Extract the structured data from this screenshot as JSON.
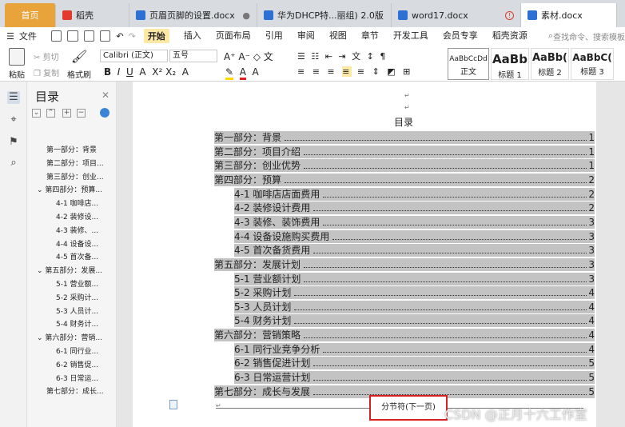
{
  "tabs": [
    {
      "label": "首页",
      "icon": "home"
    },
    {
      "label": "稻壳",
      "icon": "docer-icon"
    },
    {
      "label": "页眉页脚的设置.docx",
      "icon": "word-doc-icon",
      "mark": "●"
    },
    {
      "label": "华为DHCP特...丽组) 2.0版",
      "icon": "word-doc-icon"
    },
    {
      "label": "word17.docx",
      "icon": "word-doc-icon",
      "mark": "!"
    },
    {
      "label": "素材.docx",
      "icon": "word-doc-icon"
    }
  ],
  "menu": {
    "file": "文件",
    "items": [
      "开始",
      "插入",
      "页面布局",
      "引用",
      "审阅",
      "视图",
      "章节",
      "开发工具",
      "会员专享",
      "稻壳资源"
    ],
    "active": "开始",
    "search": "查找命令、搜索模板"
  },
  "ribbon": {
    "paste": "粘贴",
    "cut": "剪切",
    "copy": "复制",
    "format_painter": "格式刷",
    "font_name": "Calibri (正文)",
    "font_size": "五号",
    "styles": [
      {
        "sample": "AaBbCcDd",
        "label": "正文"
      },
      {
        "sample": "AaBb",
        "label": "标题 1"
      },
      {
        "sample": "AaBb(",
        "label": "标题 2"
      },
      {
        "sample": "AaBbC(",
        "label": "标题 3"
      }
    ]
  },
  "nav": {
    "title": "目录",
    "items": [
      {
        "label": "第一部分：背景",
        "level": 1
      },
      {
        "label": "第二部分：项目...",
        "level": 1
      },
      {
        "label": "第三部分：创业...",
        "level": 1
      },
      {
        "label": "第四部分：预算...",
        "level": 1,
        "expanded": true
      },
      {
        "label": "4-1 咖啡店...",
        "level": 2
      },
      {
        "label": "4-2 装修设...",
        "level": 2
      },
      {
        "label": "4-3 装修、...",
        "level": 2
      },
      {
        "label": "4-4 设备设...",
        "level": 2
      },
      {
        "label": "4-5 首次备...",
        "level": 2
      },
      {
        "label": "第五部分：发展...",
        "level": 1,
        "expanded": true
      },
      {
        "label": "5-1 营业额...",
        "level": 2
      },
      {
        "label": "5-2 采购计...",
        "level": 2
      },
      {
        "label": "5-3 人员计...",
        "level": 2
      },
      {
        "label": "5-4 财务计...",
        "level": 2
      },
      {
        "label": "第六部分：营销...",
        "level": 1,
        "expanded": true
      },
      {
        "label": "6-1 同行业...",
        "level": 2
      },
      {
        "label": "6-2 销售促...",
        "level": 2
      },
      {
        "label": "6-3 日常运...",
        "level": 2
      },
      {
        "label": "第七部分：成长...",
        "level": 1
      }
    ]
  },
  "document": {
    "toc_title": "目录",
    "entries": [
      {
        "label": "第一部分：背景",
        "page": "1",
        "level": 1
      },
      {
        "label": "第二部分：项目介绍",
        "page": "1",
        "level": 1
      },
      {
        "label": "第三部分：创业优势",
        "page": "1",
        "level": 1
      },
      {
        "label": "第四部分：预算",
        "page": "2",
        "level": 1
      },
      {
        "label": "4-1 咖啡店店面费用",
        "page": "2",
        "level": 2
      },
      {
        "label": "4-2 装修设计费用",
        "page": "2",
        "level": 2
      },
      {
        "label": "4-3 装修、装饰费用",
        "page": "3",
        "level": 2
      },
      {
        "label": "4-4 设备设施购买费用",
        "page": "3",
        "level": 2
      },
      {
        "label": "4-5 首次备货费用",
        "page": "3",
        "level": 2
      },
      {
        "label": "第五部分：发展计划",
        "page": "3",
        "level": 1
      },
      {
        "label": "5-1 营业额计划",
        "page": "3",
        "level": 2
      },
      {
        "label": "5-2 采购计划",
        "page": "4",
        "level": 2
      },
      {
        "label": "5-3 人员计划",
        "page": "4",
        "level": 2
      },
      {
        "label": "5-4 财务计划",
        "page": "4",
        "level": 2
      },
      {
        "label": "第六部分：营销策略",
        "page": "4",
        "level": 1
      },
      {
        "label": "6-1 同行业竞争分析",
        "page": "4",
        "level": 2
      },
      {
        "label": "6-2 销售促进计划",
        "page": "5",
        "level": 2
      },
      {
        "label": "6-3 日常运营计划",
        "page": "5",
        "level": 2
      },
      {
        "label": "第七部分：成长与发展",
        "page": "5",
        "level": 1
      }
    ],
    "section_break": "分节符(下一页)"
  },
  "watermark": "CSDN @正月十六工作室"
}
